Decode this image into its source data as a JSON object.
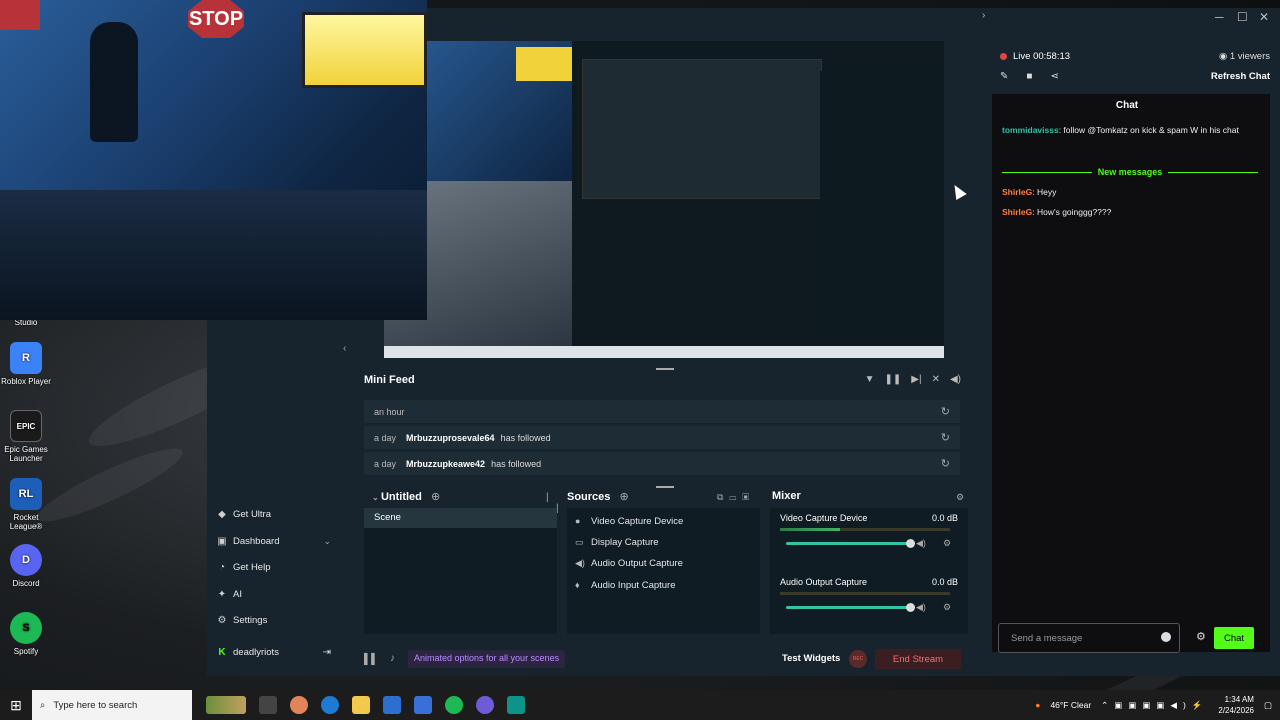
{
  "desktop": {
    "icons": [
      {
        "label": "Studio",
        "color": "#333333",
        "glyph": ""
      },
      {
        "label": "Roblox Player",
        "color": "#3b82f6",
        "glyph": "R"
      },
      {
        "label": "Epic Games Launcher",
        "color": "#1a1a1a",
        "glyph": "EPIC"
      },
      {
        "label": "Rocket League®",
        "color": "#1d5fb8",
        "glyph": "RL"
      },
      {
        "label": "Discord",
        "color": "#5865f2",
        "glyph": "D"
      },
      {
        "label": "Spotify",
        "color": "#1db954",
        "glyph": "S"
      }
    ]
  },
  "webcam": {
    "stop_sign": "STOP"
  },
  "streamlabs": {
    "sidebar": {
      "items": [
        {
          "label": "Get Ultra",
          "icon": "ultra-icon"
        },
        {
          "label": "Dashboard",
          "icon": "dashboard-icon"
        },
        {
          "label": "Get Help",
          "icon": "help-icon"
        },
        {
          "label": "AI",
          "icon": "ai-icon"
        },
        {
          "label": "Settings",
          "icon": "gear-icon"
        },
        {
          "label": "deadlyriots",
          "icon": "kick-icon"
        }
      ]
    },
    "minifeed": {
      "title": "Mini Feed",
      "rows": [
        {
          "time": "an hour",
          "user": "",
          "action": ""
        },
        {
          "time": "a day",
          "user": "Mrbuzzuprosevale64",
          "action": "has followed"
        },
        {
          "time": "a day",
          "user": "Mrbuzzupkeawe42",
          "action": "has followed"
        }
      ]
    },
    "scenes": {
      "title": "Untitled",
      "items": [
        "Scene"
      ]
    },
    "sources": {
      "title": "Sources",
      "items": [
        {
          "label": "Video Capture Device",
          "icon": "webcam-icon"
        },
        {
          "label": "Display Capture",
          "icon": "monitor-icon"
        },
        {
          "label": "Audio Output Capture",
          "icon": "speaker-icon"
        },
        {
          "label": "Audio Input Capture",
          "icon": "mic-icon"
        }
      ]
    },
    "mixer": {
      "title": "Mixer",
      "channels": [
        {
          "name": "Video Capture Device",
          "db": "0.0 dB",
          "meter_level": 0.35,
          "volume": 1.0
        },
        {
          "name": "Audio Output Capture",
          "db": "0.0 dB",
          "meter_level": 0.0,
          "volume": 1.0
        }
      ]
    },
    "bottombar": {
      "promo": "Animated options for all your scenes",
      "test_widgets": "Test Widgets",
      "rec": "REC",
      "end_stream": "End Stream"
    }
  },
  "chat": {
    "live_status": "Live 00:58:13",
    "viewers": "1 viewers",
    "refresh": "Refresh Chat",
    "title": "Chat",
    "messages_before": [
      {
        "user": "tommidavisss",
        "text": ": follow @Tomkatz on kick & spam W in his chat"
      }
    ],
    "new_messages_label": "New messages",
    "messages_after": [
      {
        "user": "ShirleG",
        "text": ": Heyy"
      },
      {
        "user": "ShirleG",
        "text": ": How's goinggg????"
      }
    ],
    "input_placeholder": "Send a message",
    "send_button": "Chat"
  },
  "taskbar": {
    "search_placeholder": "Type here to search",
    "weather": "46°F  Clear",
    "time": "1:34 AM",
    "date": "2/24/2026"
  }
}
